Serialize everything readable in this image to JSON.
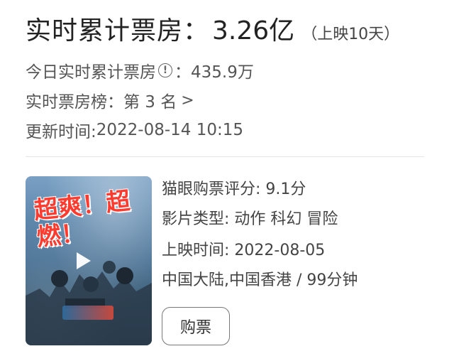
{
  "boxoffice": {
    "label": "实时累计票房：",
    "value": "3.26亿",
    "days_text": "（上映10天）"
  },
  "today": {
    "label": "今日实时累计票房",
    "info_icon": "info-circle-icon",
    "info_glyph": "!",
    "value": "：435.9万"
  },
  "rank": {
    "label": "实时票房榜：",
    "value": "第 3 名",
    "chevron": ">"
  },
  "updated": {
    "label": "更新时间: ",
    "value": "2022-08-14 10:15"
  },
  "movie": {
    "poster_text": "超爽！超燃！",
    "rating_label": "猫眼购票评分: ",
    "rating_value": "9.1分",
    "genre_label": "影片类型: ",
    "genre_value": "动作 科幻 冒险",
    "release_label": "上映时间: ",
    "release_value": "2022-08-05",
    "region_duration": "中国大陆,中国香港 / 99分钟",
    "buy_label": "购票"
  },
  "colors": {
    "poster_headline": "#ff3b2f",
    "text": "#333333"
  }
}
